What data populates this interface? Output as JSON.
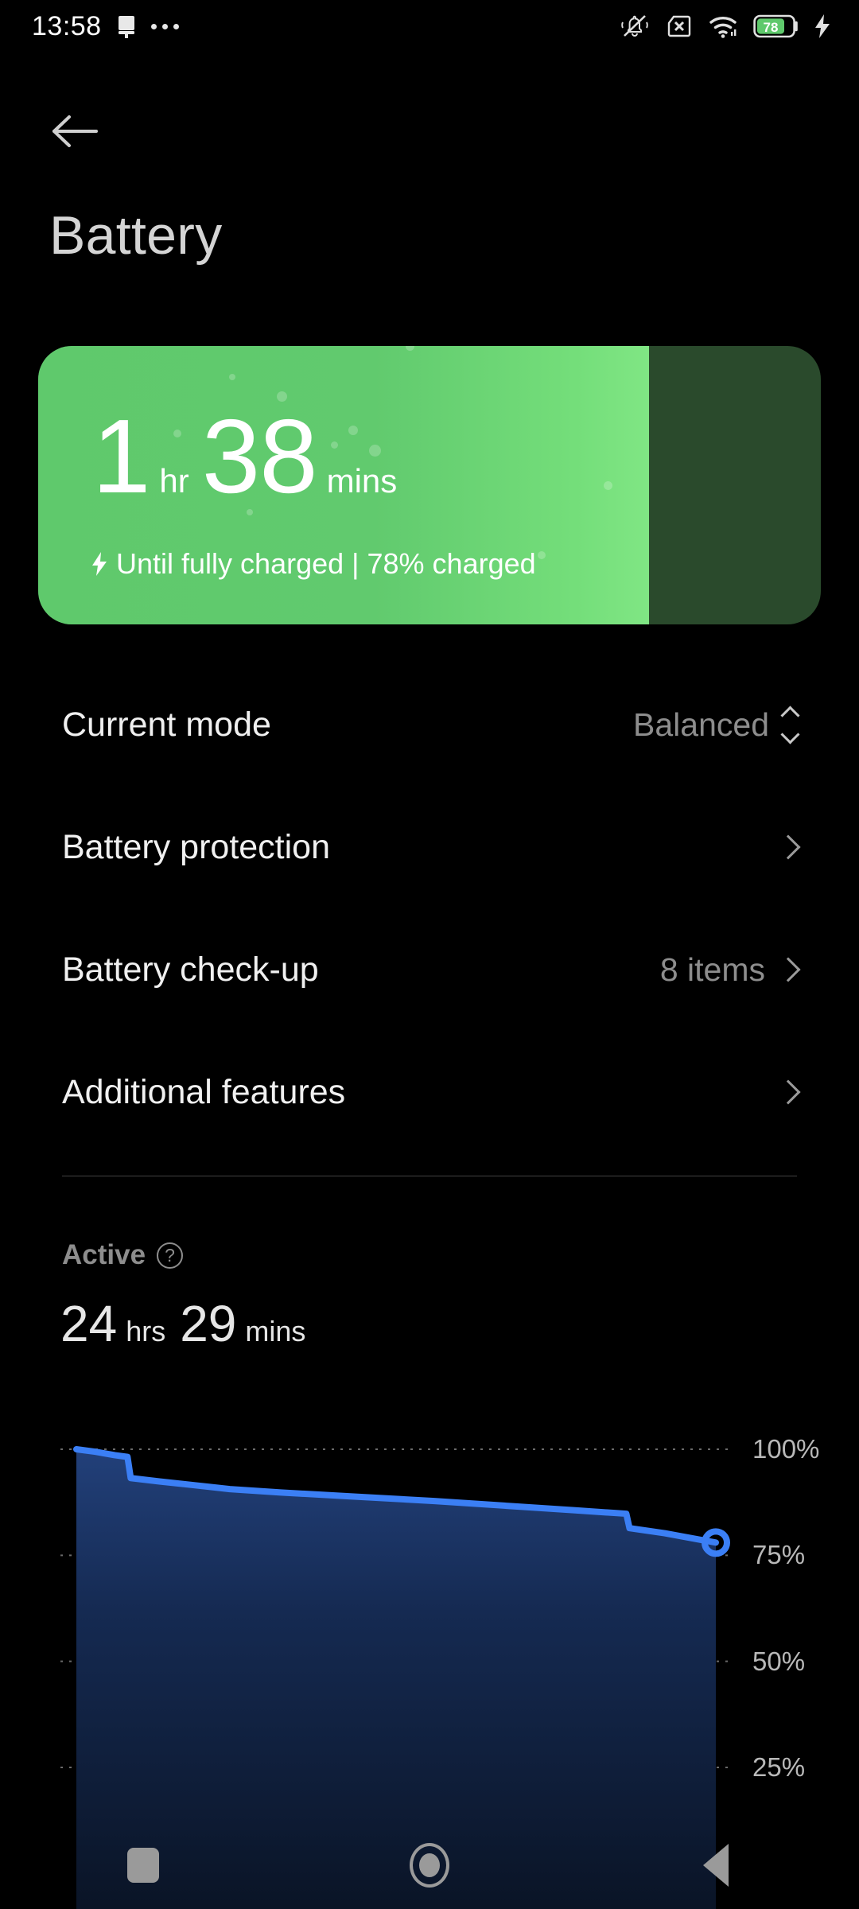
{
  "status_bar": {
    "time": "13:58",
    "left_icons": [
      "notification-icon",
      "more-dots-icon"
    ],
    "right_icons": [
      "silent-bell-slash-icon",
      "sim-card-x-icon",
      "wifi-icon",
      "battery-icon",
      "charging-bolt-icon"
    ],
    "battery_level_text": "78",
    "battery_color": "#5fc96c"
  },
  "header": {
    "back_icon": "back-arrow-icon",
    "title": "Battery"
  },
  "battery_card": {
    "hours": "1",
    "hours_unit": "hr",
    "minutes": "38",
    "minutes_unit": "mins",
    "bolt_icon": "charging-bolt-icon",
    "status_text": "Until fully charged | 78% charged",
    "fill_percent": 78,
    "fill_color": "#5fc96c",
    "fill_highlight_color": "#80e684",
    "track_color": "#2a4a2c"
  },
  "settings": {
    "rows": [
      {
        "label": "Current mode",
        "value": "Balanced",
        "accessory": "chevron-updown-icon"
      },
      {
        "label": "Battery protection",
        "value": "",
        "accessory": "chevron-right-icon"
      },
      {
        "label": "Battery check-up",
        "value": "8 items",
        "accessory": "chevron-right-icon"
      },
      {
        "label": "Additional features",
        "value": "",
        "accessory": "chevron-right-icon"
      }
    ]
  },
  "active_section": {
    "label": "Active",
    "help_icon": "help-question-icon",
    "help_glyph": "?",
    "hours": "24",
    "hours_unit": "hrs",
    "minutes": "29",
    "minutes_unit": "mins"
  },
  "chart_data": {
    "type": "area",
    "title": "",
    "xlabel": "",
    "ylabel": "",
    "ylim": [
      0,
      100
    ],
    "grid": true,
    "gridlines": [
      100,
      75,
      50,
      25
    ],
    "tick_labels": [
      "100%",
      "75%",
      "50%",
      "25%"
    ],
    "line_color": "#3b7ff5",
    "area_top_color": "#22407a",
    "area_bottom_color": "#0a1426",
    "marker": {
      "type": "hollow-circle",
      "value": 78,
      "color": "#3b7ff5"
    },
    "x": [
      0,
      3,
      6,
      8,
      8.5,
      13,
      18,
      24,
      32,
      44,
      56,
      68,
      78,
      86,
      86.5,
      92,
      100
    ],
    "values": [
      100,
      99.4,
      98.6,
      98.2,
      93.2,
      92.4,
      91.6,
      90.6,
      89.8,
      88.8,
      87.8,
      86.6,
      85.6,
      84.8,
      81.4,
      80.2,
      78
    ]
  },
  "nav_bar": {
    "buttons": [
      {
        "name": "recents",
        "icon": "square-recents-icon"
      },
      {
        "name": "home",
        "icon": "circle-home-icon"
      },
      {
        "name": "back",
        "icon": "triangle-back-icon"
      }
    ]
  }
}
